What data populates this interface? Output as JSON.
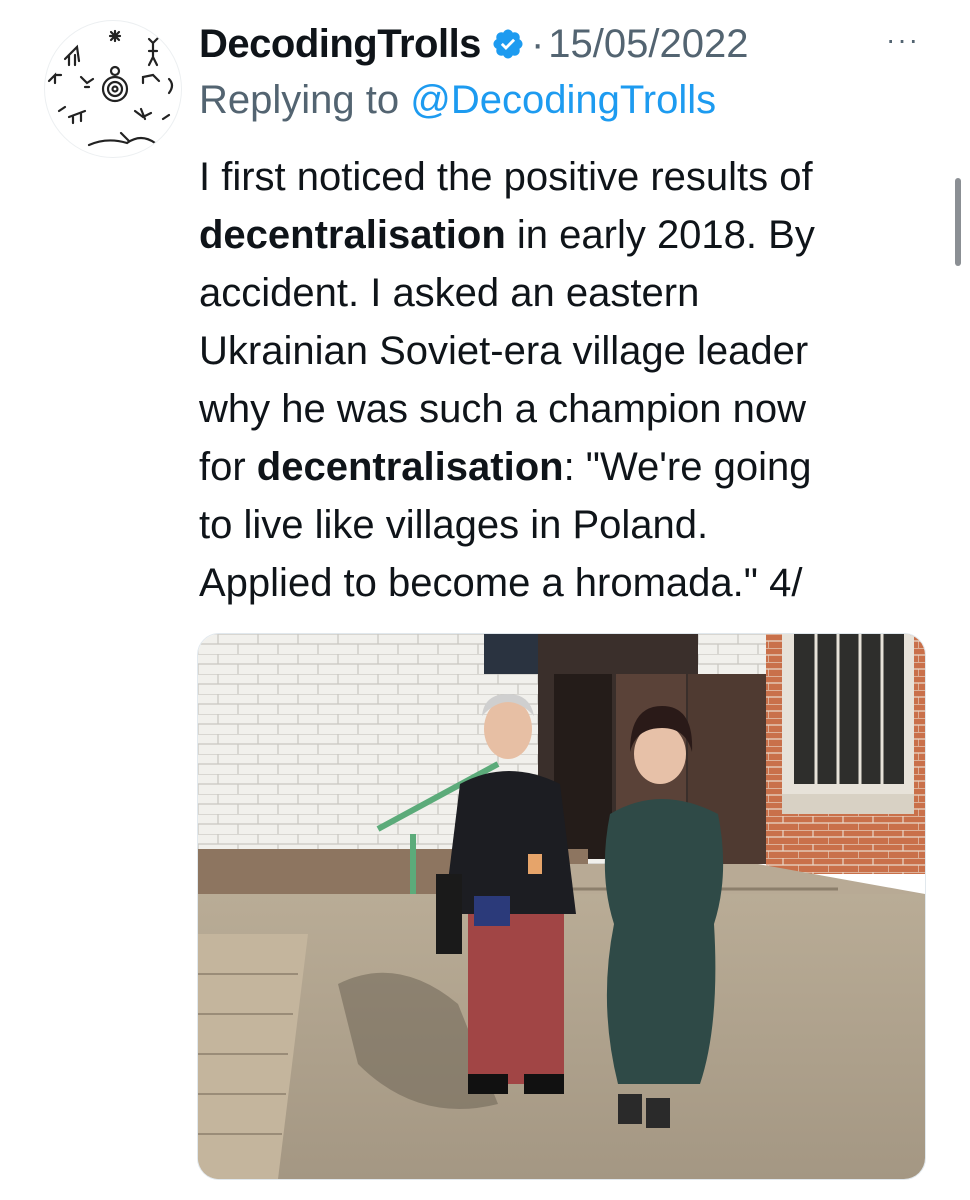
{
  "tweet": {
    "author_name": "DecodingTrolls",
    "verified": true,
    "separator": "·",
    "date": "15/05/2022",
    "more_label": "···",
    "replying_prefix": "Replying to",
    "replying_handle": "@DecodingTrolls",
    "lines": [
      {
        "before": "I first noticed the positive results of",
        "bold": "",
        "after": ""
      },
      {
        "before": "",
        "bold": "decentralisation",
        "after": " in early 2018. By"
      },
      {
        "before": "accident. I asked an eastern",
        "bold": "",
        "after": ""
      },
      {
        "before": "Ukrainian Soviet-era village leader",
        "bold": "",
        "after": ""
      },
      {
        "before": "why he was such a champion now",
        "bold": "",
        "after": ""
      },
      {
        "before": "for ",
        "bold": "decentralisation",
        "after": ": \"We're going"
      },
      {
        "before": "to live like villages in Poland.",
        "bold": "",
        "after": ""
      },
      {
        "before": "Applied to become a hromada.\" 4/",
        "bold": "",
        "after": ""
      }
    ]
  },
  "media": {
    "description_icon": "photo-icon"
  },
  "colors": {
    "text": "#0f1419",
    "secondary": "#536471",
    "link": "#1d9bf0",
    "verified": "#1d9bf0"
  }
}
